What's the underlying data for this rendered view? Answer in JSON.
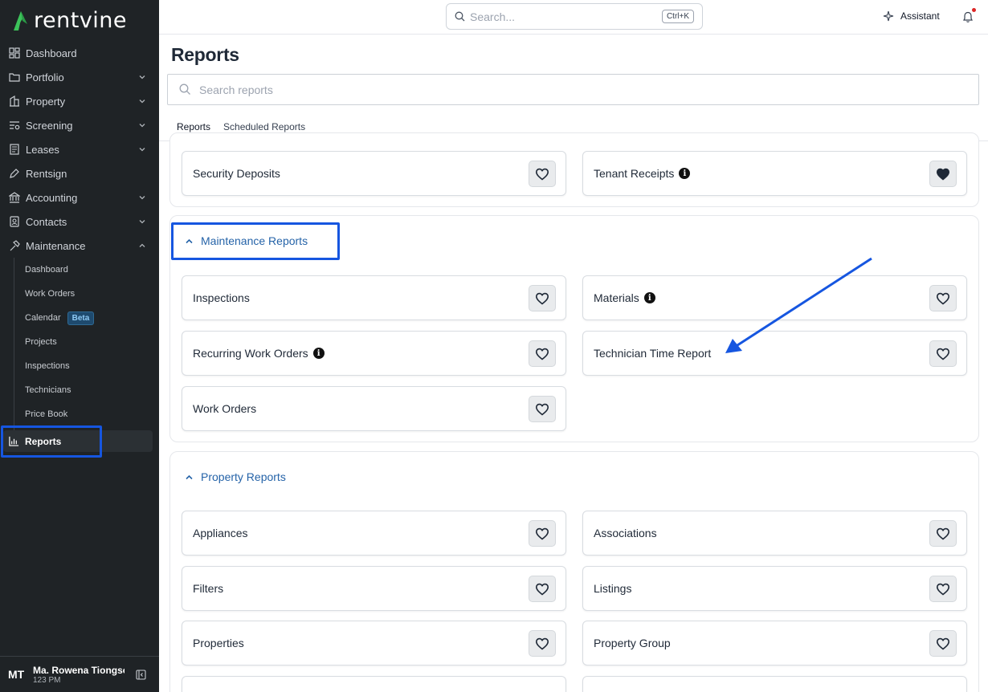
{
  "brand": {
    "name": "rentvine",
    "accent": "#1b7b3f"
  },
  "sidebar": {
    "items": [
      {
        "label": "Dashboard",
        "icon": "dashboard-icon",
        "chevron": false
      },
      {
        "label": "Portfolio",
        "icon": "folder-icon",
        "chevron": true
      },
      {
        "label": "Property",
        "icon": "building-icon",
        "chevron": true
      },
      {
        "label": "Screening",
        "icon": "screening-icon",
        "chevron": true
      },
      {
        "label": "Leases",
        "icon": "lease-icon",
        "chevron": true
      },
      {
        "label": "Rentsign",
        "icon": "pen-icon",
        "chevron": false
      },
      {
        "label": "Accounting",
        "icon": "bank-icon",
        "chevron": true
      },
      {
        "label": "Contacts",
        "icon": "contacts-icon",
        "chevron": true
      },
      {
        "label": "Maintenance",
        "icon": "hammer-icon",
        "chevron": true
      }
    ],
    "maintenance_sub": [
      "Dashboard",
      "Work Orders",
      "Calendar",
      "Projects",
      "Inspections",
      "Technicians",
      "Price Book"
    ],
    "beta_label": "Beta",
    "reports_label": "Reports",
    "user": {
      "initials": "MT",
      "name": "Ma. Rowena Tiongson",
      "sub": "123 PM"
    }
  },
  "topbar": {
    "search_placeholder": "Search...",
    "shortcut": "Ctrl+K",
    "assistant_label": "Assistant"
  },
  "main": {
    "title": "Reports",
    "search_placeholder": "Search reports",
    "tabs": [
      "Reports",
      "Scheduled Reports"
    ],
    "top_cards": [
      {
        "label": "Security Deposits",
        "info": false,
        "favorited": false
      },
      {
        "label": "Tenant Receipts",
        "info": true,
        "favorited": true
      }
    ],
    "maintenance": {
      "heading": "Maintenance Reports",
      "cards": [
        {
          "label": "Inspections",
          "info": false
        },
        {
          "label": "Materials",
          "info": true
        },
        {
          "label": "Recurring Work Orders",
          "info": true
        },
        {
          "label": "Technician Time Report",
          "info": false
        },
        {
          "label": "Work Orders",
          "info": false
        }
      ]
    },
    "property": {
      "heading": "Property Reports",
      "cards": [
        {
          "label": "Appliances",
          "info": false
        },
        {
          "label": "Associations",
          "info": false
        },
        {
          "label": "Filters",
          "info": false
        },
        {
          "label": "Listings",
          "info": false
        },
        {
          "label": "Properties",
          "info": false
        },
        {
          "label": "Property Group",
          "info": false
        }
      ]
    }
  }
}
